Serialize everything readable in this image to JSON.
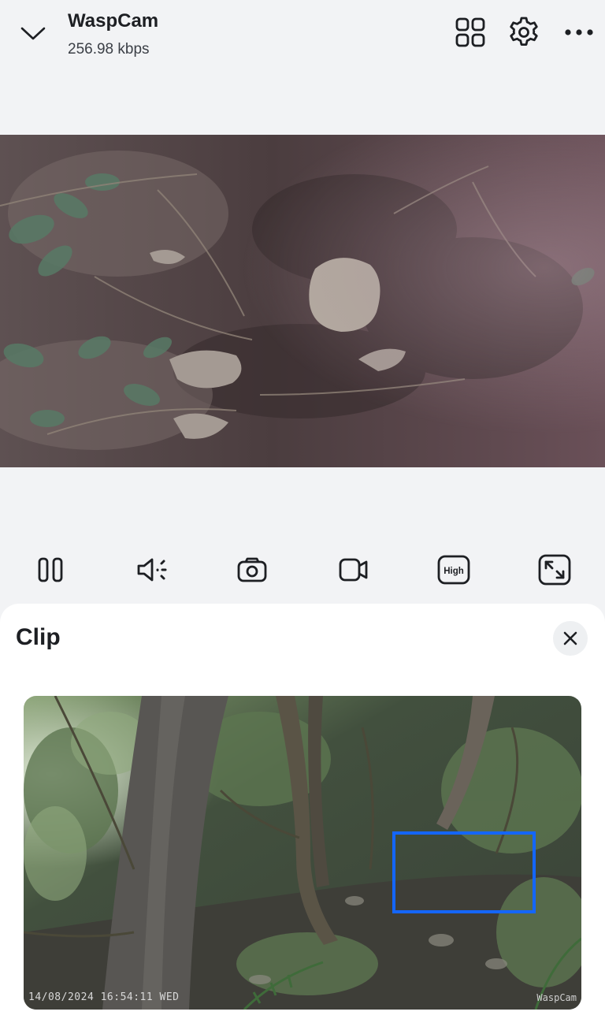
{
  "header": {
    "camera_name": "WaspCam",
    "bitrate": "256.98 kbps",
    "icons": [
      "chevron-down-icon",
      "grid-icon",
      "gear-icon",
      "more-icon"
    ]
  },
  "controls": {
    "icons": [
      "pause-icon",
      "volume-icon",
      "camera-icon",
      "video-icon",
      "quality-icon",
      "fullscreen-icon"
    ],
    "quality_label": "High"
  },
  "clip_panel": {
    "title": "Clip",
    "clip": {
      "timestamp": "14/08/2024 16:54:11 WED",
      "watermark": "WaspCam",
      "detection_color": "#1466ff"
    }
  },
  "colors": {
    "accent": "#1466ff",
    "background": "#f2f3f5",
    "sheet": "#ffffff"
  }
}
